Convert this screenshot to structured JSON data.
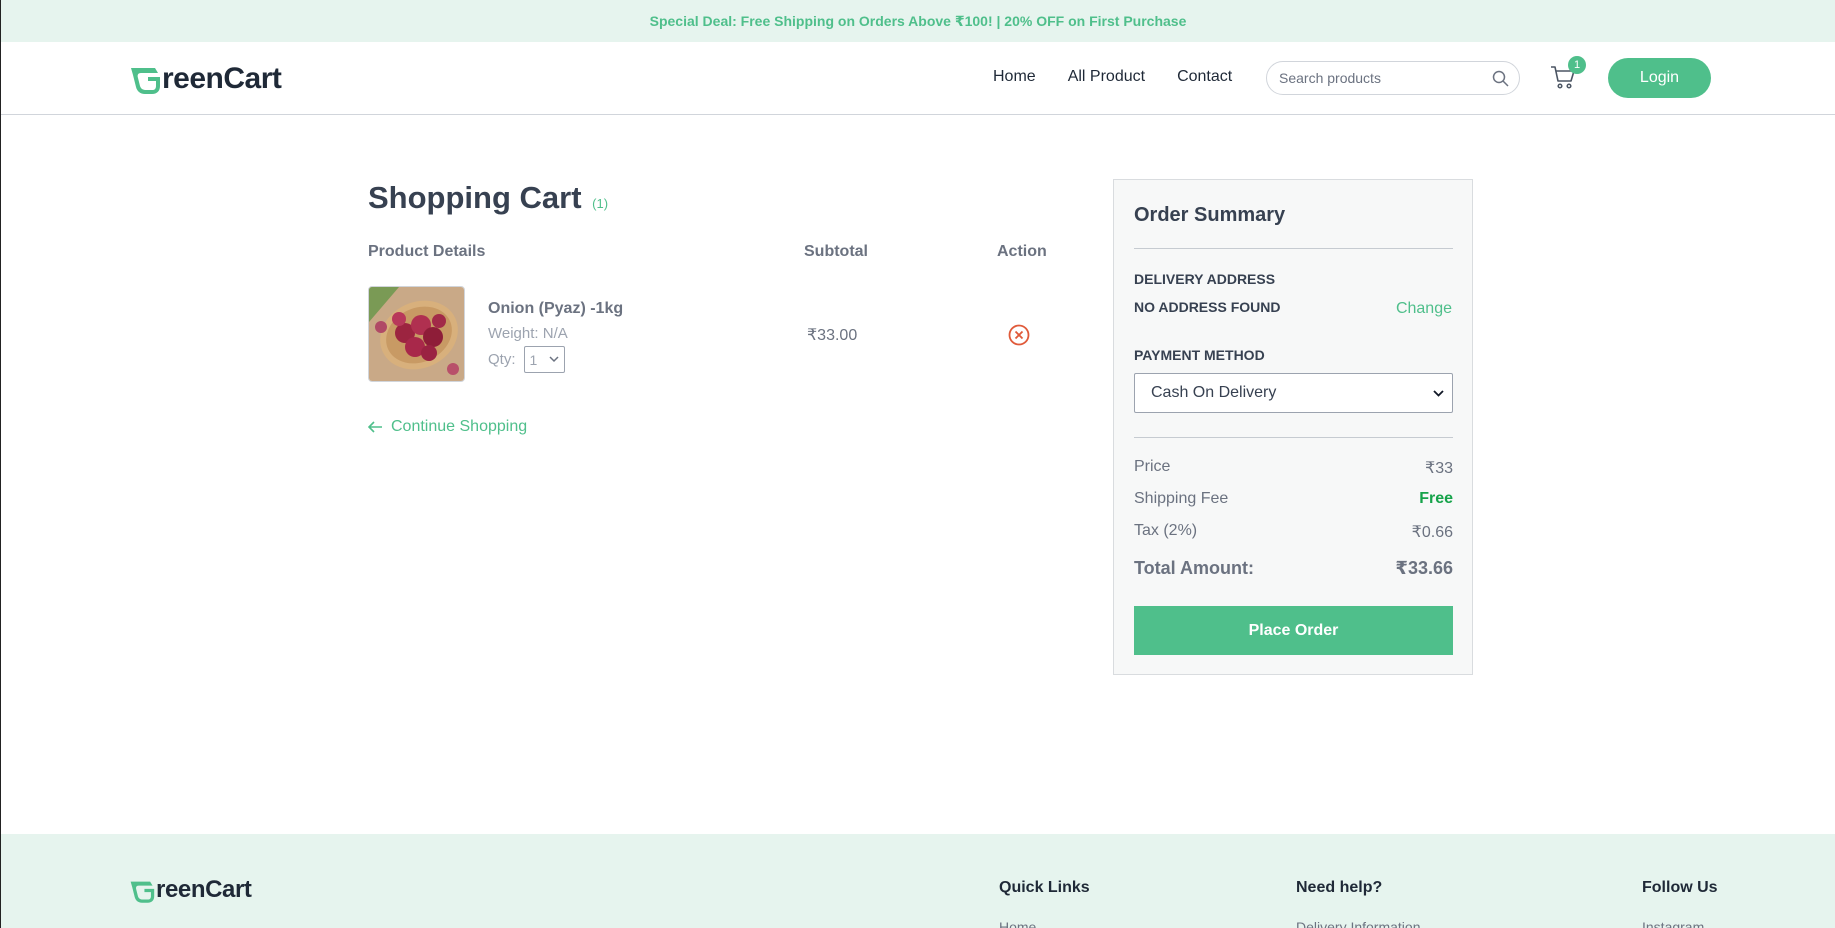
{
  "promo": {
    "text": "Special Deal: Free Shipping on Orders Above ₹100! | 20% OFF on First Purchase"
  },
  "header": {
    "logo": "GreenCart",
    "logo_rest": "reenCart",
    "nav": [
      "Home",
      "All Product",
      "Contact"
    ],
    "search_placeholder": "Search products",
    "cart_count": "1",
    "login_label": "Login"
  },
  "cart": {
    "title": "Shopping Cart",
    "count": "(1)",
    "columns": {
      "product": "Product Details",
      "subtotal": "Subtotal",
      "action": "Action"
    },
    "items": [
      {
        "name": "Onion (Pyaz) -1kg",
        "weight": "Weight: N/A",
        "qty_label": "Qty:",
        "qty": "1",
        "subtotal": "₹33.00"
      }
    ],
    "continue_label": "Continue Shopping"
  },
  "summary": {
    "title": "Order Summary",
    "delivery_label": "DELIVERY ADDRESS",
    "address": "NO ADDRESS FOUND",
    "change_label": "Change",
    "payment_label": "PAYMENT METHOD",
    "payment_selected": "Cash On Delivery",
    "price_label": "Price",
    "price": "₹33",
    "shipping_label": "Shipping Fee",
    "shipping": "Free",
    "tax_label": "Tax (2%)",
    "tax": "₹0.66",
    "total_label": "Total Amount:",
    "total": "₹33.66",
    "place_order_label": "Place Order"
  },
  "footer": {
    "logo_rest": "reenCart",
    "quick_links": "Quick Links",
    "quick_first": "Home",
    "need_help": "Need help?",
    "help_first": "Delivery Information",
    "follow_us": "Follow Us",
    "follow_first": "Instagram"
  },
  "colors": {
    "accent": "#4fbf8b",
    "promo_bg": "#e6f4ee",
    "free": "#16a34a",
    "remove": "#e05a3a"
  }
}
